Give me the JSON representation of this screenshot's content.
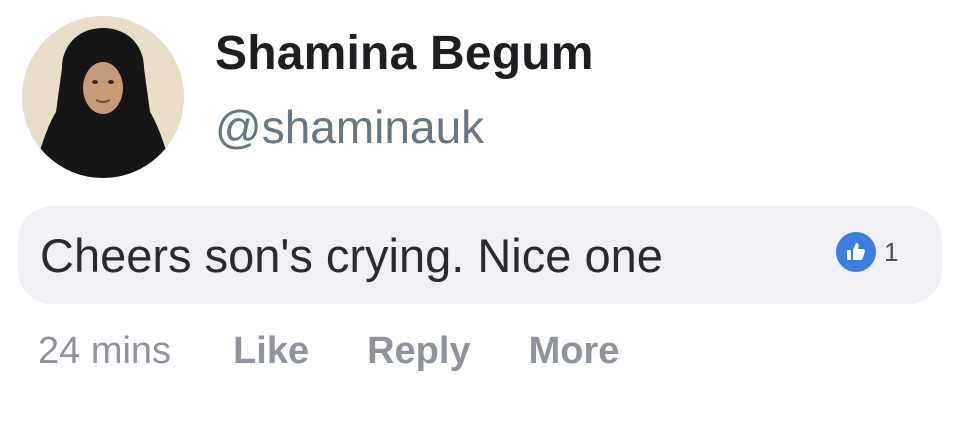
{
  "post": {
    "author": {
      "display_name": "Shamina Begum",
      "handle": "@shaminauk"
    },
    "comment": {
      "text": "Cheers son's crying. Nice one",
      "reaction_icon": "like-icon",
      "reaction_count": "1"
    },
    "meta": {
      "timestamp": "24 mins",
      "like_label": "Like",
      "reply_label": "Reply",
      "more_label": "More"
    }
  },
  "colors": {
    "name_text": "#1c1e21",
    "handle_text": "#657786",
    "bubble_bg": "#f0f0f5",
    "like_blue": "#3b7de0",
    "action_gray": "#8d949e"
  }
}
